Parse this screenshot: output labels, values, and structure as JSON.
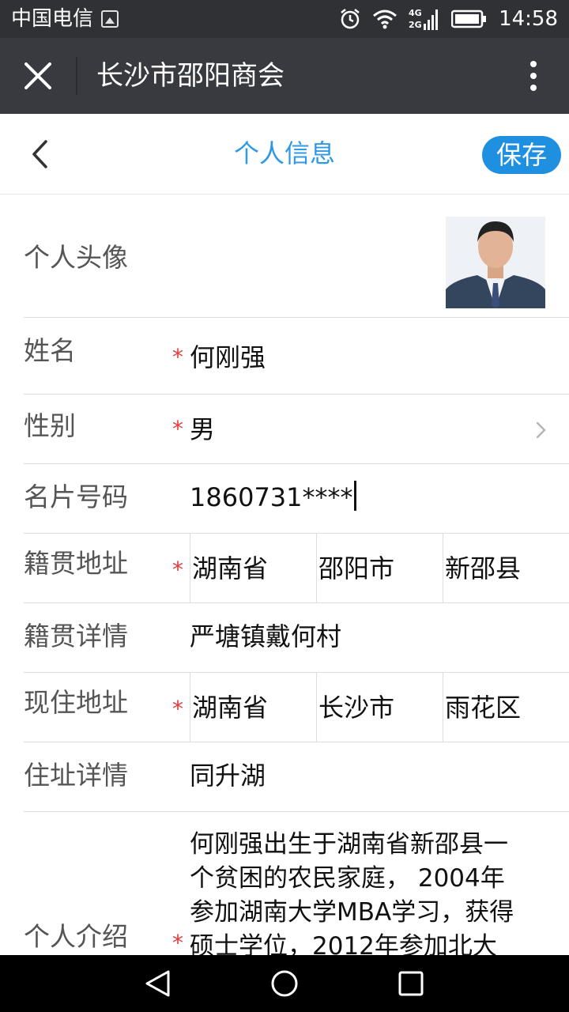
{
  "status_bar": {
    "carrier": "中国电信",
    "network": "4G 2G",
    "time": "14:58"
  },
  "wechat_bar": {
    "title": "长沙市邵阳商会"
  },
  "nav": {
    "title": "个人信息",
    "save_label": "保存"
  },
  "form": {
    "avatar_label": "个人头像",
    "name": {
      "label": "姓名",
      "required": "*",
      "value": "何刚强"
    },
    "gender": {
      "label": "性别",
      "required": "*",
      "value": "男"
    },
    "card_number": {
      "label": "名片号码",
      "value": "1860731****"
    },
    "native_address": {
      "label": "籍贯地址",
      "required": "*",
      "province": "湖南省",
      "city": "邵阳市",
      "county": "新邵县"
    },
    "native_detail": {
      "label": "籍贯详情",
      "value": "严塘镇戴何村"
    },
    "current_address": {
      "label": "现住地址",
      "required": "*",
      "province": "湖南省",
      "city": "长沙市",
      "district": "雨花区"
    },
    "address_detail": {
      "label": "住址详情",
      "value": "同升湖"
    },
    "intro": {
      "label": "个人介绍",
      "required": "*",
      "lines": [
        "何刚强出生于湖南省新邵县一",
        "个贫困的农民家庭， 2004年",
        "参加湖南大学MBA学习，获得",
        "硕士学位，2012年参加北大"
      ]
    }
  },
  "colors": {
    "accent": "#2d9ae3",
    "save_button": "#1f8fe0",
    "required": "#e63b3b"
  },
  "icons": {
    "close": "close-icon",
    "more": "more-vertical-icon",
    "back": "chevron-left-icon",
    "chevron": "chevron-right-icon",
    "nav_back": "triangle-back-icon",
    "nav_home": "circle-home-icon",
    "nav_recent": "square-recent-icon"
  }
}
